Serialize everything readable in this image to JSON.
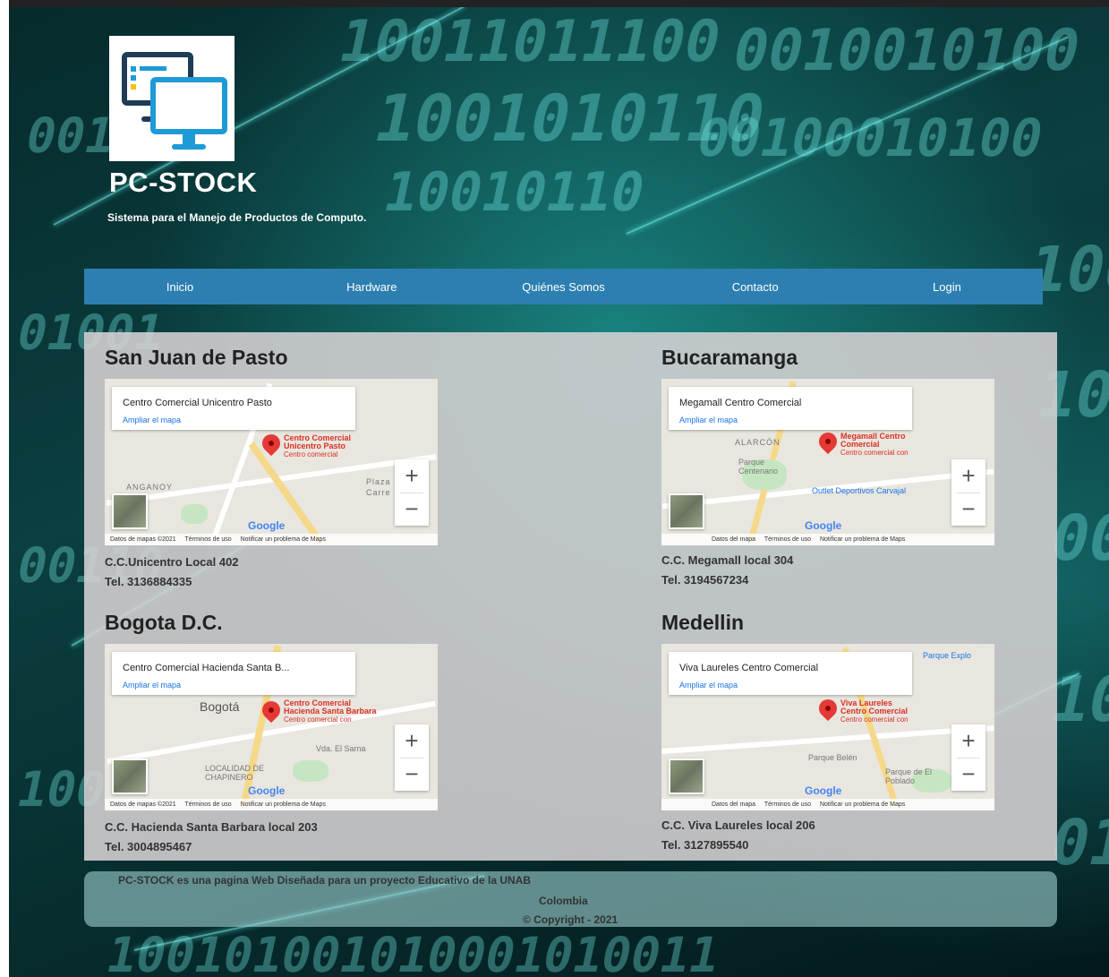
{
  "site": {
    "title": "PC-STOCK",
    "subtitle": "Sistema para el Manejo de Productos de Computo.",
    "logo_icon": "desktop-monitors-icon"
  },
  "nav": {
    "items": [
      "Inicio",
      "Hardware",
      "Quiénes Somos",
      "Contacto",
      "Login"
    ],
    "color": "#2d7fb1"
  },
  "branches": [
    {
      "city": "San Juan de Pasto",
      "map_place": "Centro Comercial Unicentro Pasto",
      "map_link": "Ampliar el mapa",
      "pin_label": [
        "Centro Comercial",
        "Unicentro Pasto",
        "Centro comercial"
      ],
      "map_labels": [
        "ANGANOY",
        "Plaza",
        "Carre"
      ],
      "map_footer": [
        "Datos de mapas ©2021",
        "Términos de uso",
        "Notificar un problema de Maps"
      ],
      "address": "C.C.Unicentro Local 402",
      "phone": "Tel. 3136884335"
    },
    {
      "city": "Bucaramanga",
      "map_place": "Megamall Centro Comercial",
      "map_link": "Ampliar el mapa",
      "pin_label": [
        "Megamall Centro",
        "Comercial",
        "Centro comercial con"
      ],
      "map_labels": [
        "ALARCÓN",
        "Parque Centenario",
        "Outlet Deportivos Carvajal"
      ],
      "map_footer": [
        "Datos del mapa",
        "Términos de uso",
        "Notificar un problema de Maps"
      ],
      "address": "C.C. Megamall local 304",
      "phone": "Tel. 3194567234"
    },
    {
      "city": "Bogota D.C.",
      "map_place": "Centro Comercial Hacienda Santa B...",
      "map_link": "Ampliar el mapa",
      "pin_label": [
        "Centro Comercial",
        "Hacienda Santa Barbara",
        "Centro comercial con"
      ],
      "map_labels": [
        "Bogotá",
        "LOCALIDAD DE CHAPINERO",
        "Vda. El Sarna"
      ],
      "map_footer": [
        "Datos de mapas ©2021",
        "Términos de uso",
        "Notificar un problema de Maps"
      ],
      "address": "C.C. Hacienda Santa Barbara local 203",
      "phone": "Tel. 3004895467"
    },
    {
      "city": "Medellin",
      "map_place": "Viva Laureles Centro Comercial",
      "map_link": "Ampliar el mapa",
      "pin_label": [
        "Viva Laureles",
        "Centro Comercial",
        "Centro comercial con"
      ],
      "map_labels": [
        "Parque Explo",
        "Parque Belén",
        "Parque de El Poblado"
      ],
      "map_footer": [
        "Datos del mapa",
        "Términos de uso",
        "Notificar un problema de Maps"
      ],
      "address": "C.C. Viva Laureles local 206",
      "phone": "Tel. 3127895540"
    }
  ],
  "map_common": {
    "google": "Google",
    "zoom_in": "+",
    "zoom_out": "−"
  },
  "footer": {
    "line1": "PC-STOCK es una pagina Web Diseñada para un proyecto Educativo de la UNAB",
    "line2": "Colombia",
    "line3": "© Copyright - 2021"
  }
}
